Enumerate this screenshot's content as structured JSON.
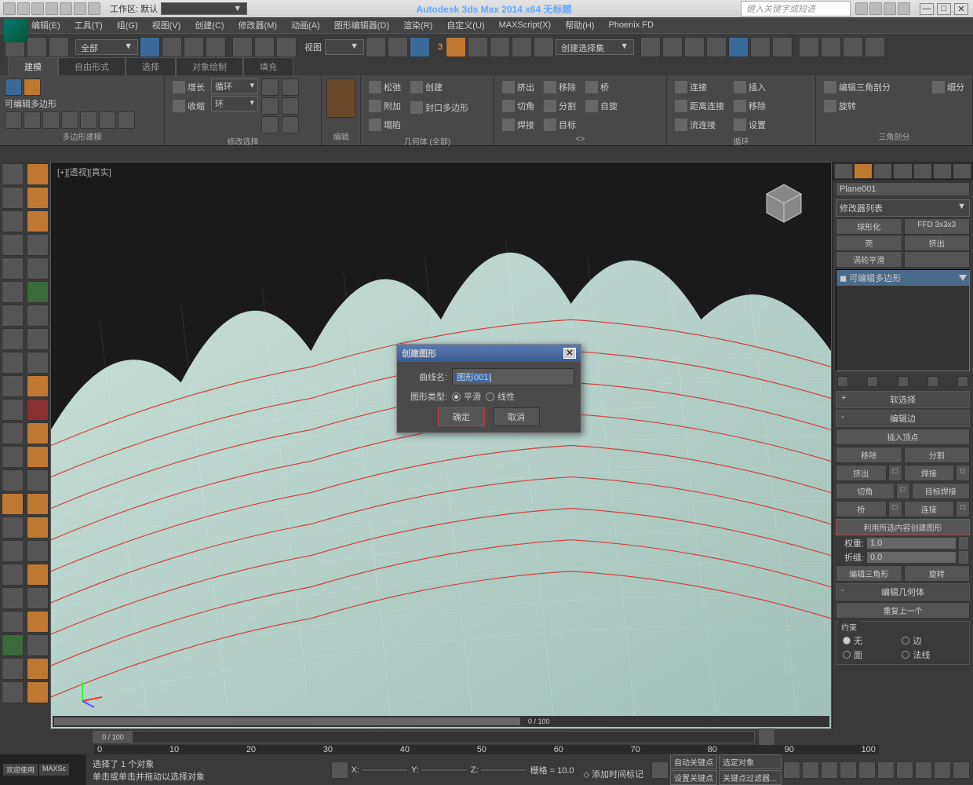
{
  "titlebar": {
    "workspace_label": "工作区: 默认",
    "title": "Autodesk 3ds Max 2014 x64   无标题",
    "search_placeholder": "键入关键字或短语"
  },
  "menubar": {
    "items": [
      "编辑(E)",
      "工具(T)",
      "组(G)",
      "视图(V)",
      "创建(C)",
      "修改器(M)",
      "动画(A)",
      "图形编辑器(D)",
      "渲染(R)",
      "自定义(U)",
      "MAXScript(X)",
      "帮助(H)",
      "Phoenix FD"
    ]
  },
  "toolbar1": {
    "selection_dd": "全部",
    "view_label": "视图",
    "three_label": "3",
    "named_sel_dd": "创建选择集"
  },
  "ribbon": {
    "tabs": [
      "建模",
      "自由形式",
      "选择",
      "对象绘制",
      "填充"
    ],
    "active_tab": 0,
    "panels": {
      "poly_model": {
        "title": "多边形建模",
        "label": "可编辑多边形"
      },
      "modify_sel": {
        "title": "修改选择",
        "grow": "增长",
        "shrink": "收缩",
        "loop": "循环",
        "ring": "环"
      },
      "edit": {
        "title": "编辑"
      },
      "geom_all": {
        "title": "几何体 (全部)",
        "relax": "松弛",
        "attach": "附加",
        "collapse": "塌陷",
        "create": "创建",
        "cap_poly": "封口多边形"
      },
      "subdiv": {
        "title": "",
        "extrude": "挤出",
        "chamfer": "切角",
        "weld": "焊接",
        "remove": "移除",
        "split": "分割",
        "target": "目标",
        "bridge": "桥",
        "spin": "自旋"
      },
      "loops": {
        "title": "循环",
        "connect": "连接",
        "dist_connect": "距离连接",
        "flow_connect": "流连接",
        "remove": "移除",
        "settings": "设置",
        "insert": "插入"
      },
      "tris": {
        "title": "三角剖分",
        "edit_tri": "编辑三角剖分",
        "rotate": "旋转"
      },
      "detail": "细分"
    }
  },
  "viewport": {
    "label": "[+][透视][真实]",
    "time_display": "0 / 100"
  },
  "right_panel": {
    "object_name": "Plane001",
    "modifier_list_label": "修改器列表",
    "mod_row1": [
      "球形化",
      "FFD 3x3x3"
    ],
    "mod_row2": [
      "壳",
      "挤出"
    ],
    "mod_row3": "涡轮平滑",
    "stack_item": "可编辑多边形",
    "soft_sel": "软选择",
    "edit_edges_hdr": "编辑边",
    "insert_vertex": "插入顶点",
    "buttons": {
      "remove": "移除",
      "split": "分割",
      "extrude": "挤出",
      "weld": "焊接",
      "chamfer": "切角",
      "target_weld": "目标焊接",
      "bridge": "桥",
      "connect": "连接",
      "create_shape": "利用所选内容创建图形",
      "weight_lbl": "权重:",
      "weight_val": "1.0",
      "crease_lbl": "折缝:",
      "crease_val": "0.0",
      "edit_tri": "编辑三角形",
      "rotate": "旋转"
    },
    "edit_geom_hdr": "编辑几何体",
    "repeat_last": "重复上一个",
    "constraints_hdr": "约束",
    "constraints": {
      "none": "无",
      "edge": "边",
      "face": "面",
      "normal": "法线"
    }
  },
  "dialog": {
    "title": "创建图形",
    "curve_name_lbl": "曲线名:",
    "curve_name_val": "图形001",
    "shape_type_lbl": "图形类型:",
    "smooth": "平滑",
    "linear": "线性",
    "ok": "确定",
    "cancel": "取消"
  },
  "timeline": {
    "handle": "0 / 100",
    "frames": [
      "0",
      "10",
      "20",
      "30",
      "40",
      "50",
      "60",
      "70",
      "80",
      "90",
      "100"
    ]
  },
  "status": {
    "welcome": "欢迎使用",
    "maxsc": "MAXSc",
    "line1": "选择了 1 个对象",
    "line2": "单击或单击并拖动以选择对象",
    "x_lbl": "X:",
    "y_lbl": "Y:",
    "z_lbl": "Z:",
    "grid_lbl": "栅格 = 10.0",
    "add_time_tag": "添加时间标记",
    "auto_key": "自动关键点",
    "set_key": "设置关键点",
    "sel_obj": "选定对象",
    "key_filter": "关键点过滤器..."
  }
}
